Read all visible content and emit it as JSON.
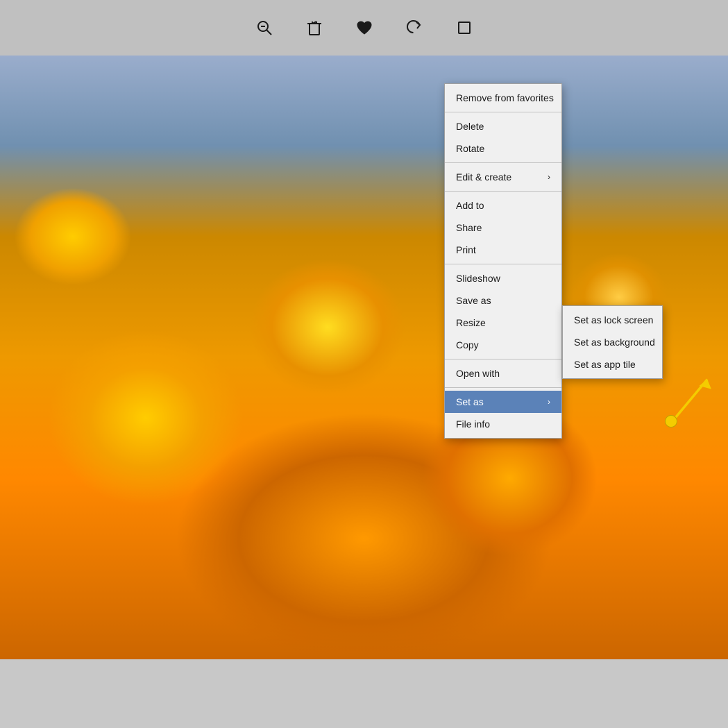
{
  "toolbar": {
    "icons": [
      {
        "name": "zoom-icon",
        "symbol": "🔍",
        "label": "Zoom"
      },
      {
        "name": "delete-icon",
        "symbol": "🗑",
        "label": "Delete"
      },
      {
        "name": "favorite-icon",
        "symbol": "♥",
        "label": "Favorite"
      },
      {
        "name": "rotate-icon",
        "symbol": "↺",
        "label": "Rotate"
      },
      {
        "name": "crop-icon",
        "symbol": "⊡",
        "label": "Crop"
      }
    ]
  },
  "context_menu": {
    "items": [
      {
        "id": "remove-favorites",
        "label": "Remove from favorites",
        "separator_after": true,
        "has_submenu": false
      },
      {
        "id": "delete",
        "label": "Delete",
        "separator_after": false,
        "has_submenu": false
      },
      {
        "id": "rotate",
        "label": "Rotate",
        "separator_after": true,
        "has_submenu": false
      },
      {
        "id": "edit-create",
        "label": "Edit & create",
        "separator_after": true,
        "has_submenu": true
      },
      {
        "id": "add-to",
        "label": "Add to",
        "separator_after": false,
        "has_submenu": false
      },
      {
        "id": "share",
        "label": "Share",
        "separator_after": false,
        "has_submenu": false
      },
      {
        "id": "print",
        "label": "Print",
        "separator_after": true,
        "has_submenu": false
      },
      {
        "id": "slideshow",
        "label": "Slideshow",
        "separator_after": false,
        "has_submenu": false
      },
      {
        "id": "save-as",
        "label": "Save as",
        "separator_after": false,
        "has_submenu": false
      },
      {
        "id": "resize",
        "label": "Resize",
        "separator_after": false,
        "has_submenu": false
      },
      {
        "id": "copy",
        "label": "Copy",
        "separator_after": true,
        "has_submenu": false
      },
      {
        "id": "open-with",
        "label": "Open with",
        "separator_after": true,
        "has_submenu": false
      },
      {
        "id": "set-as",
        "label": "Set as",
        "separator_after": false,
        "has_submenu": true,
        "highlighted": true
      },
      {
        "id": "file-info",
        "label": "File info",
        "separator_after": false,
        "has_submenu": false
      }
    ]
  },
  "submenu": {
    "items": [
      {
        "id": "set-lock-screen",
        "label": "Set as lock screen"
      },
      {
        "id": "set-background",
        "label": "Set as background"
      },
      {
        "id": "set-app-tile",
        "label": "Set as app tile"
      }
    ]
  },
  "colors": {
    "menu_bg": "#f0f0f0",
    "menu_highlight": "#5b82b8",
    "separator": "#c0c0c0",
    "toolbar_bg": "#c0c0c0",
    "app_bg": "#c8c8c8"
  }
}
